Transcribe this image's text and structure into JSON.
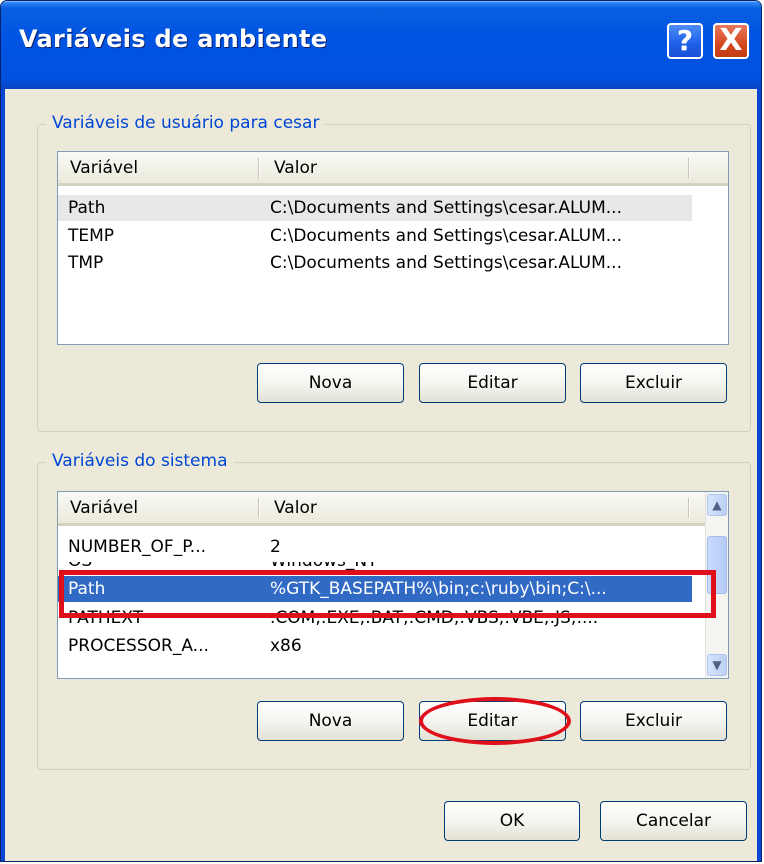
{
  "window": {
    "title": "Variáveis de ambiente",
    "help_label": "?",
    "close_label": "X"
  },
  "user_vars": {
    "group_title": "Variáveis de usuário para cesar",
    "columns": [
      "Variável",
      "Valor"
    ],
    "rows": [
      {
        "name": "Path",
        "value": "C:\\Documents and Settings\\cesar.ALUM..."
      },
      {
        "name": "TEMP",
        "value": "C:\\Documents and Settings\\cesar.ALUM..."
      },
      {
        "name": "TMP",
        "value": "C:\\Documents and Settings\\cesar.ALUM..."
      }
    ],
    "buttons": {
      "new": "Nova",
      "edit": "Editar",
      "delete": "Excluir"
    }
  },
  "system_vars": {
    "group_title": "Variáveis do sistema",
    "columns": [
      "Variável",
      "Valor"
    ],
    "rows": [
      {
        "name": "NUMBER_OF_P...",
        "value": "2"
      },
      {
        "name": "OS",
        "value": "Windows_NT"
      },
      {
        "name": "Path",
        "value": "%GTK_BASEPATH%\\bin;c:\\ruby\\bin;C:\\..."
      },
      {
        "name": "PATHEXT",
        "value": ".COM;.EXE;.BAT;.CMD;.VBS;.VBE;.JS;...."
      },
      {
        "name": "PROCESSOR_A...",
        "value": "x86"
      }
    ],
    "selected_index": 2,
    "buttons": {
      "new": "Nova",
      "edit": "Editar",
      "delete": "Excluir"
    }
  },
  "footer": {
    "ok": "OK",
    "cancel": "Cancelar"
  },
  "colors": {
    "titlebar": "#0054e3",
    "selection": "#316ac5",
    "annotation": "#e0101b",
    "dialog_bg": "#ece9d8"
  }
}
